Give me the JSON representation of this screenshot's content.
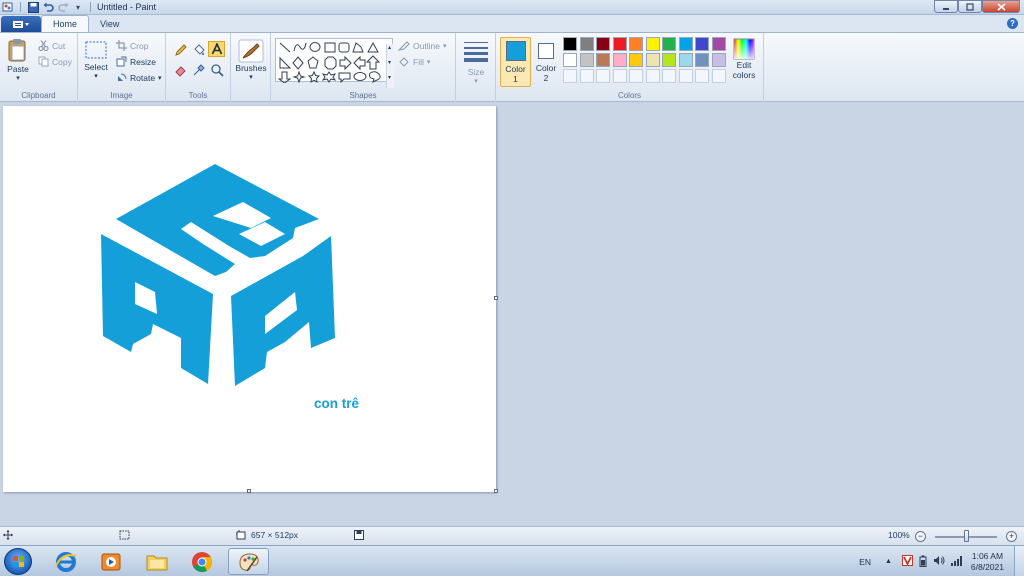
{
  "window": {
    "title": "Untitled - Paint"
  },
  "tabs": [
    {
      "label": "Home",
      "active": true
    },
    {
      "label": "View",
      "active": false
    }
  ],
  "ribbon": {
    "clipboard": {
      "label": "Clipboard",
      "paste": "Paste",
      "cut": "Cut",
      "copy": "Copy"
    },
    "image": {
      "label": "Image",
      "select": "Select",
      "crop": "Crop",
      "resize": "Resize",
      "rotate": "Rotate"
    },
    "tools": {
      "label": "Tools"
    },
    "brushes": {
      "label": "Brushes"
    },
    "shapes": {
      "label": "Shapes",
      "outline": "Outline",
      "fill": "Fill"
    },
    "size": {
      "label": "Size"
    },
    "colors": {
      "label": "Colors",
      "color1_label": "Color",
      "color1_num": "1",
      "color2_label": "Color",
      "color2_num": "2",
      "edit_line1": "Edit",
      "edit_line2": "colors",
      "color1_value": "#159fd8",
      "color2_value": "#ffffff",
      "palette_row1": [
        "#000000",
        "#7f7f7f",
        "#880015",
        "#ed1c24",
        "#ff7f27",
        "#fff200",
        "#22b14c",
        "#00a2e8",
        "#3f48cc",
        "#a349a4"
      ],
      "palette_row2": [
        "#ffffff",
        "#c3c3c3",
        "#b97a57",
        "#ffaec9",
        "#ffc90e",
        "#efe4b0",
        "#b5e61d",
        "#99d9ea",
        "#7092be",
        "#c8bfe7"
      ]
    }
  },
  "canvas": {
    "text": "con trê",
    "logo_color": "#159fd8"
  },
  "statusbar": {
    "dimensions": "657 × 512px",
    "zoom": "100%",
    "zoom_minus": "−",
    "zoom_plus": "+"
  },
  "taskbar": {
    "language": "EN",
    "time": "1:06 AM",
    "date": "6/8/2021"
  }
}
